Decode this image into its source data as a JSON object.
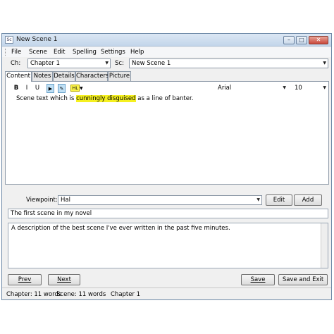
{
  "window": {
    "title": "New Scene 1",
    "icon_text": "Sc"
  },
  "menu": [
    "File",
    "Scene",
    "Edit",
    "Spelling",
    "Settings",
    "Help"
  ],
  "chapter": {
    "label": "Ch:",
    "value": "Chapter 1"
  },
  "scene": {
    "label": "Sc:",
    "value": "New Scene 1"
  },
  "tabs": [
    "Content",
    "Notes",
    "Details",
    "Characters",
    "Picture"
  ],
  "toolbar": {
    "bold": "B",
    "italic": "I",
    "underline": "U",
    "highlight": "HL",
    "font": "Arial",
    "size": "10"
  },
  "content": {
    "before": "Scene text which is ",
    "highlighted": "cunningly disguised",
    "after": " as a line of banter."
  },
  "viewpoint": {
    "label": "Viewpoint:",
    "value": "Hal",
    "edit_label": "Edit",
    "add_label": "Add"
  },
  "summary": "The first scene in my novel",
  "description": "A description of the best scene I've ever written in the past five minutes.",
  "buttons": {
    "prev": "Prev",
    "next": "Next",
    "save": "Save",
    "save_exit": "Save and Exit"
  },
  "status": {
    "chapter_words": "Chapter: 11 words",
    "scene_words": "Scene: 11 words",
    "chapter_name": "Chapter 1"
  },
  "colors": {
    "highlight": "#f5f020",
    "titlebar": "#c3d6ea",
    "close": "#c9473a"
  },
  "icons": [
    "app-icon",
    "play-icon",
    "pencil-icon",
    "highlight-icon",
    "chevron-down-icon"
  ]
}
